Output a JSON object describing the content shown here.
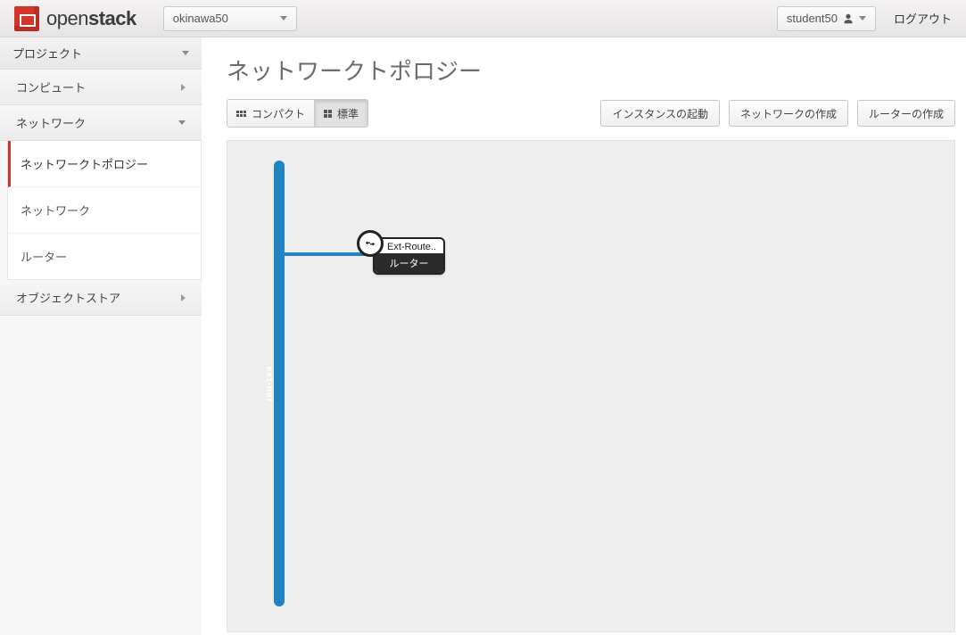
{
  "brand": {
    "name_light": "open",
    "name_bold": "stack"
  },
  "tenant": {
    "selected": "okinawa50"
  },
  "user": {
    "name": "student50"
  },
  "logout": "ログアウト",
  "sidebar": {
    "category": "プロジェクト",
    "groups": {
      "compute": "コンピュート",
      "network": "ネットワーク",
      "object_store": "オブジェクトストア"
    },
    "network_items": {
      "topology": "ネットワークトポロジー",
      "networks": "ネットワーク",
      "routers": "ルーター"
    }
  },
  "page": {
    "title": "ネットワークトポロジー"
  },
  "toolbar": {
    "compact": "コンパクト",
    "standard": "標準",
    "launch_instance": "インスタンスの起動",
    "create_network": "ネットワークの作成",
    "create_router": "ルーターの作成"
  },
  "topology": {
    "network_name": "ext-net",
    "router_name": "Ext-Route..",
    "router_type": "ルーター"
  }
}
